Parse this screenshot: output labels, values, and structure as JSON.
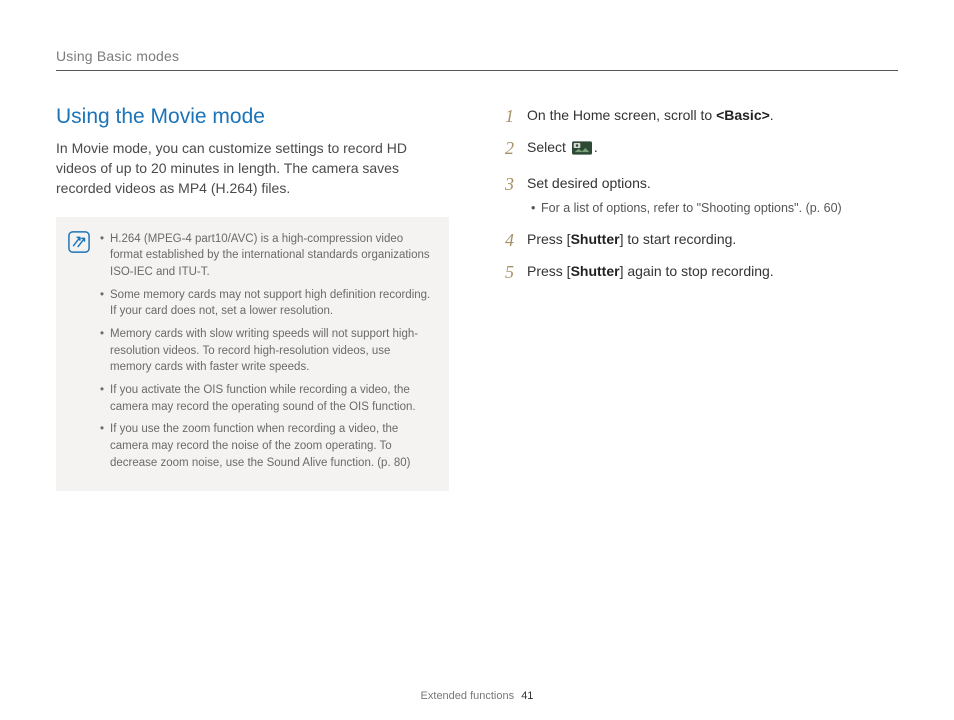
{
  "header": {
    "running": "Using Basic modes"
  },
  "left": {
    "title": "Using the Movie mode",
    "intro": "In Movie mode, you can customize settings to record HD videos of up to 20 minutes in length. The camera saves recorded videos as MP4 (H.264) files.",
    "notes": [
      "H.264 (MPEG-4 part10/AVC) is a high-compression video format established by the international standards organizations ISO-IEC and ITU-T.",
      "Some memory cards may not support high definition recording. If your card does not, set a lower resolution.",
      "Memory cards with slow writing speeds will not support high-resolution videos. To record high-resolution videos, use memory cards with faster write speeds.",
      "If you activate the OIS function while recording a video, the camera may record the operating sound of the OIS function.",
      "If you use the zoom function when recording a video, the camera may record the noise of the zoom operating. To decrease zoom noise, use the Sound Alive function. (p. 80)"
    ]
  },
  "right": {
    "steps": {
      "s1_a": "On the Home screen, scroll to ",
      "s1_b": "<Basic>",
      "s1_c": ".",
      "s2_a": "Select ",
      "s2_b": ".",
      "s3": "Set desired options.",
      "s3_sub": "For a list of options, refer to \"Shooting options\". (p. 60)",
      "s4_a": "Press [",
      "s4_b": "Shutter",
      "s4_c": "] to start recording.",
      "s5_a": "Press [",
      "s5_b": "Shutter",
      "s5_c": "] again to stop recording."
    }
  },
  "footer": {
    "section": "Extended functions",
    "page": "41"
  }
}
